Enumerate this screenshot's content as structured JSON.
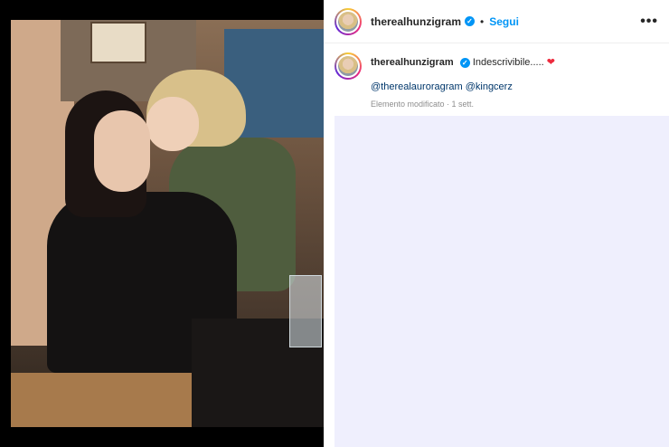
{
  "post": {
    "username": "therealhunzigram",
    "follow_label": "Segui",
    "separator": "•",
    "more_label": "•••"
  },
  "caption": {
    "username": "therealhunzigram",
    "text": "Indescrivibile.....",
    "mentions": "@therealauroragram @kingcerz",
    "meta": "Elemento modificato · 1 sett."
  },
  "colors": {
    "accent": "#0095f6",
    "heart": "#ed2a3d"
  }
}
